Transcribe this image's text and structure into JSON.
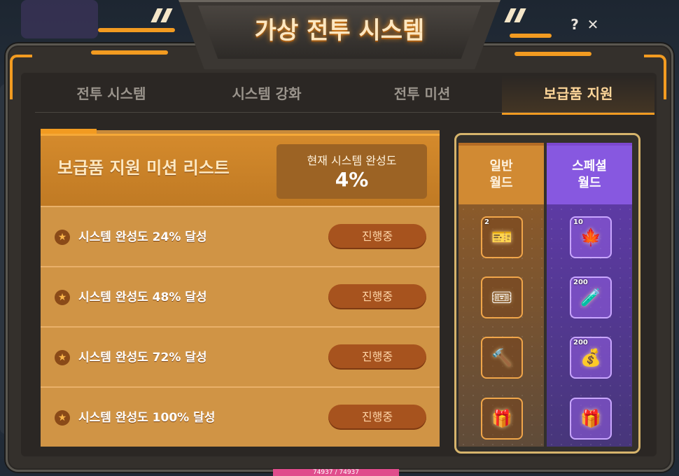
{
  "window": {
    "title": "가상 전투 시스템",
    "help_label": "?",
    "close_label": "✕"
  },
  "tabs": [
    {
      "label": "전투 시스템",
      "active": false
    },
    {
      "label": "시스템 강화",
      "active": false
    },
    {
      "label": "전투 미션",
      "active": false
    },
    {
      "label": "보급품 지원",
      "active": true
    }
  ],
  "mission_list": {
    "title": "보급품 지원 미션 리스트",
    "completion_label": "현재 시스템 완성도",
    "completion_value": "4%",
    "missions": [
      {
        "label": "시스템 완성도 24% 달성",
        "status": "진행중"
      },
      {
        "label": "시스템 완성도 48% 달성",
        "status": "진행중"
      },
      {
        "label": "시스템 완성도 72% 달성",
        "status": "진행중"
      },
      {
        "label": "시스템 완성도 100% 달성",
        "status": "진행중"
      }
    ]
  },
  "rewards": {
    "normal_world": {
      "label_line1": "일반",
      "label_line2": "월드",
      "items": [
        {
          "icon": "coin-ticket-icon",
          "glyph": "🎫",
          "count": "2"
        },
        {
          "icon": "ticket-card-icon",
          "glyph": "🎟",
          "count": ""
        },
        {
          "icon": "hammer-icon",
          "glyph": "🔨",
          "count": ""
        },
        {
          "icon": "gift-box-icon",
          "glyph": "🎁",
          "count": ""
        }
      ]
    },
    "special_world": {
      "label_line1": "스페셜",
      "label_line2": "월드",
      "items": [
        {
          "icon": "maple-leaf-box-icon",
          "glyph": "🍁",
          "count": "10"
        },
        {
          "icon": "potion-icon",
          "glyph": "🧪",
          "count": "200"
        },
        {
          "icon": "meso-bag-icon",
          "glyph": "💰",
          "count": "200"
        },
        {
          "icon": "gift-box-icon",
          "glyph": "🎁",
          "count": ""
        }
      ]
    }
  },
  "status_bar": {
    "hp_text": "74937 / 74937"
  },
  "colors": {
    "accent_orange": "#f29b21",
    "special_purple": "#8758e0",
    "status_pill": "#a7531e"
  }
}
